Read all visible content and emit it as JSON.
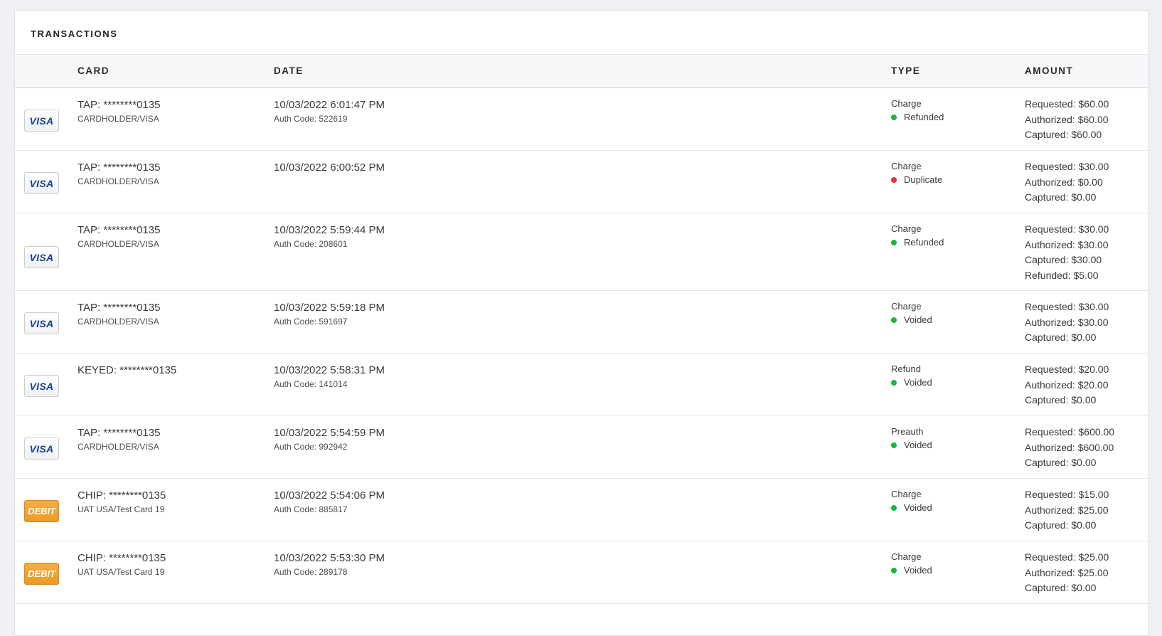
{
  "title": "TRANSACTIONS",
  "columns": {
    "card": "CARD",
    "date": "DATE",
    "type": "TYPE",
    "amount": "AMOUNT"
  },
  "colors": {
    "success": "#14b83c",
    "danger": "#e0323c",
    "visa_text": "#1a3f8f",
    "debit_bg": "#ee9e2b"
  },
  "rows": [
    {
      "logo": "VISA",
      "logo_icon": "visa-card-icon",
      "card": "TAP: ********0135",
      "card_sub": "CARDHOLDER/VISA",
      "date": "10/03/2022 6:01:47 PM",
      "auth": "Auth Code: 522619",
      "type": "Charge",
      "status": "Refunded",
      "status_color": "#14b83c",
      "amounts": [
        "Requested: $60.00",
        "Authorized: $60.00",
        "Captured: $60.00"
      ]
    },
    {
      "logo": "VISA",
      "logo_icon": "visa-card-icon",
      "card": "TAP: ********0135",
      "card_sub": "CARDHOLDER/VISA",
      "date": "10/03/2022 6:00:52 PM",
      "auth": "",
      "type": "Charge",
      "status": "Duplicate",
      "status_color": "#e0323c",
      "amounts": [
        "Requested: $30.00",
        "Authorized: $0.00",
        "Captured: $0.00"
      ]
    },
    {
      "logo": "VISA",
      "logo_icon": "visa-card-icon",
      "card": "TAP: ********0135",
      "card_sub": "CARDHOLDER/VISA",
      "date": "10/03/2022 5:59:44 PM",
      "auth": "Auth Code: 208601",
      "type": "Charge",
      "status": "Refunded",
      "status_color": "#14b83c",
      "amounts": [
        "Requested: $30.00",
        "Authorized: $30.00",
        "Captured: $30.00",
        "Refunded: $5.00"
      ]
    },
    {
      "logo": "VISA",
      "logo_icon": "visa-card-icon",
      "card": "TAP: ********0135",
      "card_sub": "CARDHOLDER/VISA",
      "date": "10/03/2022 5:59:18 PM",
      "auth": "Auth Code: 591697",
      "type": "Charge",
      "status": "Voided",
      "status_color": "#14b83c",
      "amounts": [
        "Requested: $30.00",
        "Authorized: $30.00",
        "Captured: $0.00"
      ]
    },
    {
      "logo": "VISA",
      "logo_icon": "visa-card-icon",
      "card": "KEYED: ********0135",
      "card_sub": "",
      "date": "10/03/2022 5:58:31 PM",
      "auth": "Auth Code: 141014",
      "type": "Refund",
      "status": "Voided",
      "status_color": "#14b83c",
      "amounts": [
        "Requested: $20.00",
        "Authorized: $20.00",
        "Captured: $0.00"
      ]
    },
    {
      "logo": "VISA",
      "logo_icon": "visa-card-icon",
      "card": "TAP: ********0135",
      "card_sub": "CARDHOLDER/VISA",
      "date": "10/03/2022 5:54:59 PM",
      "auth": "Auth Code: 992942",
      "type": "Preauth",
      "status": "Voided",
      "status_color": "#14b83c",
      "amounts": [
        "Requested: $600.00",
        "Authorized: $600.00",
        "Captured: $0.00"
      ]
    },
    {
      "logo": "DEBIT",
      "logo_icon": "debit-card-icon",
      "card": "CHIP: ********0135",
      "card_sub": "UAT USA/Test Card 19",
      "date": "10/03/2022 5:54:06 PM",
      "auth": "Auth Code: 885817",
      "type": "Charge",
      "status": "Voided",
      "status_color": "#14b83c",
      "amounts": [
        "Requested: $15.00",
        "Authorized: $25.00",
        "Captured: $0.00"
      ]
    },
    {
      "logo": "DEBIT",
      "logo_icon": "debit-card-icon",
      "card": "CHIP: ********0135",
      "card_sub": "UAT USA/Test Card 19",
      "date": "10/03/2022 5:53:30 PM",
      "auth": "Auth Code: 289178",
      "type": "Charge",
      "status": "Voided",
      "status_color": "#14b83c",
      "amounts": [
        "Requested: $25.00",
        "Authorized: $25.00",
        "Captured: $0.00"
      ]
    }
  ]
}
